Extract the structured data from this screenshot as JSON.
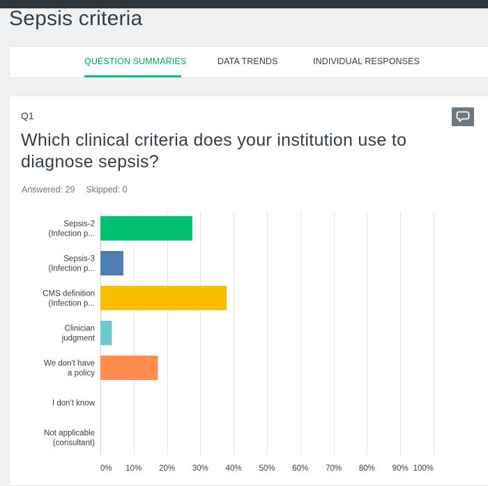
{
  "page": {
    "title": "Sepsis criteria"
  },
  "tabs": [
    {
      "label": "QUESTION SUMMARIES",
      "active": true
    },
    {
      "label": "DATA TRENDS",
      "active": false
    },
    {
      "label": "INDIVIDUAL RESPONSES",
      "active": false
    }
  ],
  "question": {
    "number": "Q1",
    "text": "Which clinical criteria does your institution use to diagnose sepsis?",
    "answered": "Answered: 29",
    "skipped": "Skipped: 0",
    "comment_icon": "speech-bubble-icon"
  },
  "colors": {
    "brand_green": "#00bf6f",
    "background": "#eff1f2",
    "text": "#333e48"
  },
  "chart_data": {
    "type": "bar",
    "orientation": "horizontal",
    "categories": [
      [
        "Sepsis-2",
        "(Infection p..."
      ],
      [
        "Sepsis-3",
        "(Infection p..."
      ],
      [
        "CMS definition",
        "(Infection p..."
      ],
      [
        "Clinician",
        "judgment"
      ],
      [
        "We don't have",
        "a policy"
      ],
      [
        "I don't know"
      ],
      [
        "Not applicable",
        "(consultant)"
      ]
    ],
    "values": [
      27.59,
      6.9,
      37.93,
      3.45,
      17.24,
      0,
      0
    ],
    "colors": [
      "#00bf6f",
      "#507cb6",
      "#f9be00",
      "#6bc8cd",
      "#ff8b4f",
      "#7d8d97",
      "#e3e7ea"
    ],
    "xlim": [
      0,
      100
    ],
    "xticks": [
      "0%",
      "10%",
      "20%",
      "30%",
      "40%",
      "50%",
      "60%",
      "70%",
      "80%",
      "90%",
      "100%"
    ],
    "grid": true
  }
}
